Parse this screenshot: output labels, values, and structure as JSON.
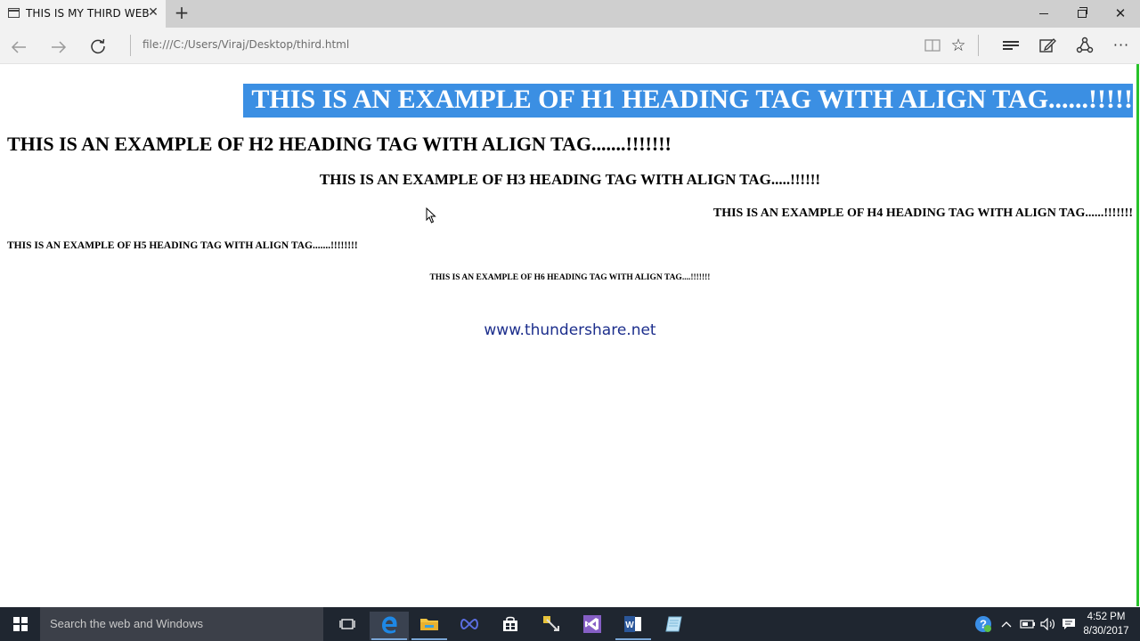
{
  "browser": {
    "tab_title": "THIS IS MY THIRD WEB",
    "address": "file:///C:/Users/Viraj/Desktop/third.html",
    "icons": [
      "page-icon",
      "close-icon",
      "plus-icon",
      "minimize-icon",
      "maximize-icon",
      "close-window-icon",
      "back-icon",
      "forward-icon",
      "refresh-icon",
      "reading-view-icon",
      "favorite-star-icon",
      "hub-icon",
      "web-note-icon",
      "share-icon",
      "more-icon"
    ]
  },
  "page": {
    "h1": "THIS IS AN EXAMPLE OF H1 HEADING TAG WITH ALIGN TAG......!!!!!",
    "h2": "THIS IS AN EXAMPLE OF H2 HEADING TAG WITH ALIGN TAG.......!!!!!!!",
    "h3": "THIS IS AN EXAMPLE OF H3 HEADING TAG WITH ALIGN TAG.....!!!!!!",
    "h4": "THIS IS AN EXAMPLE OF H4 HEADING TAG WITH ALIGN TAG......!!!!!!!",
    "h5": "THIS IS AN EXAMPLE OF H5 HEADING TAG WITH ALIGN TAG.......!!!!!!!!",
    "h6": "THIS IS AN EXAMPLE OF H6 HEADING TAG WITH ALIGN TAG....!!!!!!!",
    "watermark": "www.thundershare.net",
    "selection_color": "#3b8fe3"
  },
  "taskbar": {
    "search_placeholder": "Search the web and Windows",
    "time": "4:52 PM",
    "date": "8/30/2017",
    "apps": [
      "task-view-icon",
      "edge-icon",
      "file-explorer-icon",
      "infinity-app-icon",
      "store-icon",
      "tools-app-icon",
      "visual-studio-icon",
      "word-icon",
      "notepad-icon"
    ],
    "tray_icons": [
      "help-icon",
      "chevron-up-icon",
      "battery-icon",
      "volume-icon",
      "notifications-icon"
    ]
  }
}
